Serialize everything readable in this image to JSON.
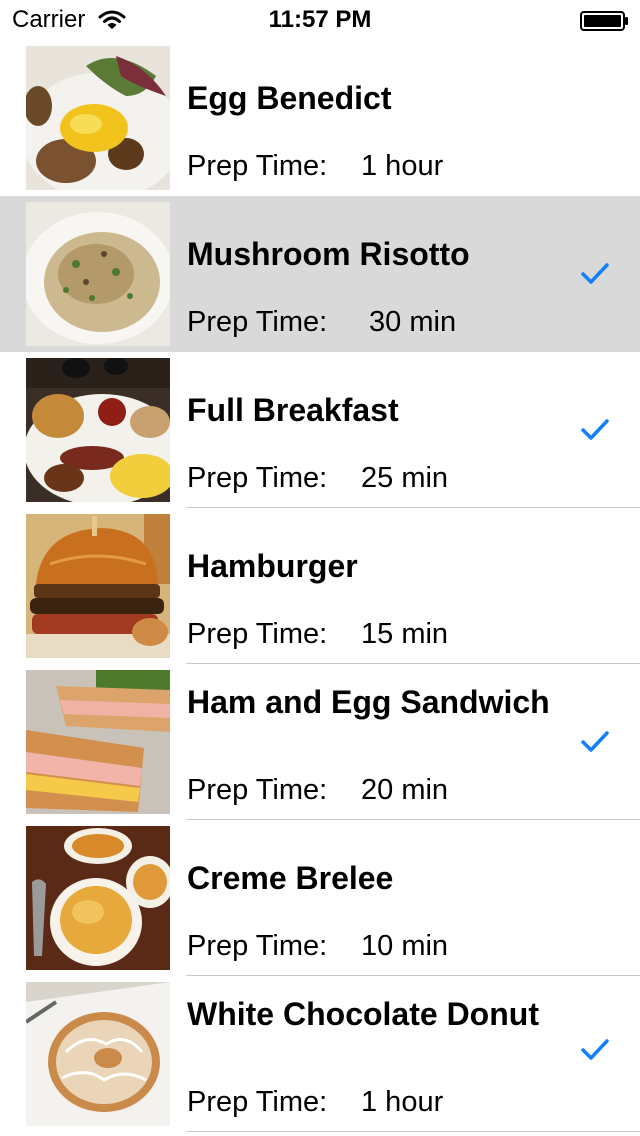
{
  "status_bar": {
    "carrier": "Carrier",
    "time": "11:57 PM"
  },
  "accent_color": "#147efb",
  "selected_row_color": "#d9d9d9",
  "recipes": [
    {
      "name": "Egg Benedict",
      "prep_label": "Prep Time:",
      "prep_value": "1 hour",
      "checked": false,
      "selected": false
    },
    {
      "name": "Mushroom Risotto",
      "prep_label": "Prep Time:",
      "prep_value": " 30 min",
      "checked": true,
      "selected": true
    },
    {
      "name": "Full Breakfast",
      "prep_label": "Prep Time:",
      "prep_value": "25 min",
      "checked": true,
      "selected": false
    },
    {
      "name": "Hamburger",
      "prep_label": "Prep Time:",
      "prep_value": "15 min",
      "checked": false,
      "selected": false
    },
    {
      "name": "Ham and Egg Sandwich",
      "prep_label": "Prep Time:",
      "prep_value": "20 min",
      "checked": true,
      "selected": false
    },
    {
      "name": "Creme Brelee",
      "prep_label": "Prep Time:",
      "prep_value": "10 min",
      "checked": false,
      "selected": false
    },
    {
      "name": "White Chocolate Donut",
      "prep_label": "Prep Time:",
      "prep_value": "1 hour",
      "checked": true,
      "selected": false
    }
  ]
}
